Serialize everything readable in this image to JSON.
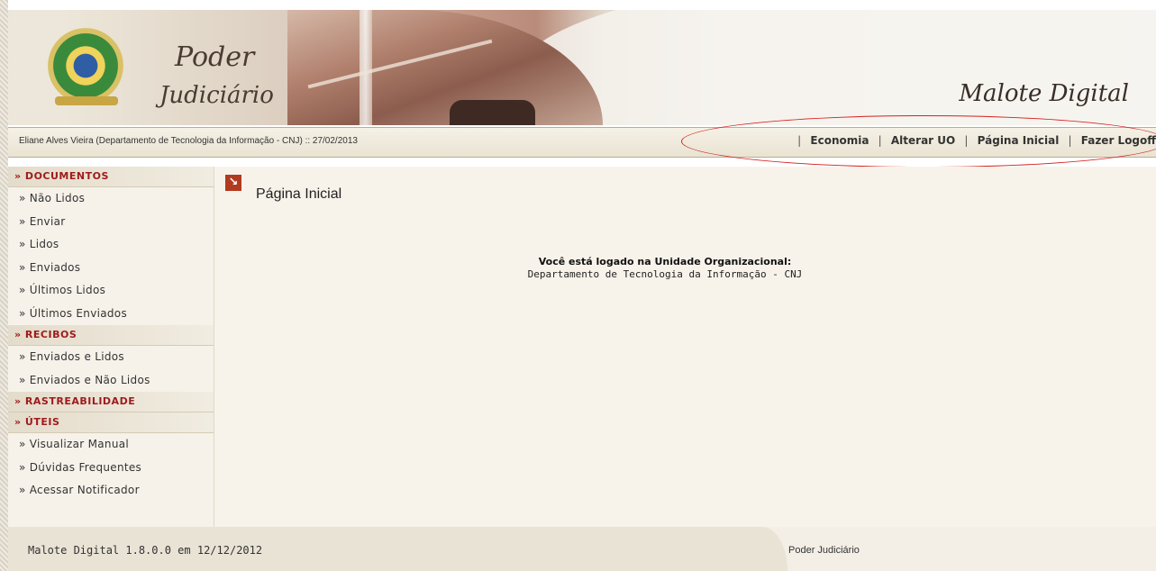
{
  "header": {
    "logo_line1": "Poder",
    "logo_line2": "Judiciário",
    "app_title": "Malote Digital"
  },
  "userbar": {
    "user_info": "Eliane Alves Vieira (Departamento de Tecnologia da Informação - CNJ) :: 27/02/2013",
    "nav": [
      {
        "label": "Economia"
      },
      {
        "label": "Alterar UO"
      },
      {
        "label": "Página Inicial"
      },
      {
        "label": "Fazer Logoff"
      }
    ],
    "separator": "|"
  },
  "sidebar": {
    "sections": [
      {
        "title": "» DOCUMENTOS",
        "items": [
          "» Não Lidos",
          "» Enviar",
          "» Lidos",
          "» Enviados",
          "» Últimos Lidos",
          "» Últimos Enviados"
        ]
      },
      {
        "title": "» RECIBOS",
        "items": [
          "» Enviados e Lidos",
          "» Enviados e Não Lidos"
        ]
      },
      {
        "title": "» RASTREABILIDADE",
        "items": []
      },
      {
        "title": "» ÚTEIS",
        "items": [
          "» Visualizar Manual",
          "» Dúvidas Frequentes",
          "» Acessar Notificador"
        ]
      }
    ]
  },
  "main": {
    "icon": "arrow-down-right-icon",
    "icon_glyph": "↘",
    "title": "Página Inicial",
    "logged_label": "Você está logado na Unidade Organizacional:",
    "logged_unit": "Departamento de Tecnologia da Informação - CNJ"
  },
  "footer": {
    "version": "Malote Digital 1.8.0.0 em 12/12/2012",
    "org": "Poder Judiciário"
  },
  "colors": {
    "section_title": "#9e1b1b",
    "highlight_oval": "#d42020",
    "page_icon": "#b23a1e"
  }
}
